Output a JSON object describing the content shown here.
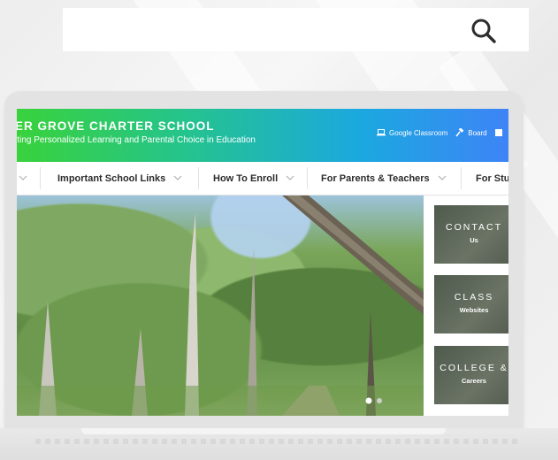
{
  "search": {
    "icon": "search-icon"
  },
  "site": {
    "school_name": "ER GROVE CHARTER SCHOOL",
    "tagline": "rting Personalized Learning and Parental Choice in Education",
    "header_links": [
      {
        "label": "Google Classroom",
        "icon": "laptop-icon"
      },
      {
        "label": "Board",
        "icon": "gavel-icon"
      }
    ]
  },
  "nav": {
    "items": [
      {
        "label": "Important School Links"
      },
      {
        "label": "How To Enroll"
      },
      {
        "label": "For Parents & Teachers"
      },
      {
        "label": "For Stu"
      }
    ]
  },
  "cards": [
    {
      "title": "CONTACT",
      "subtitle": "Us"
    },
    {
      "title": "CLASS",
      "subtitle": "Websites"
    },
    {
      "title": "COLLEGE &",
      "subtitle": "Careers"
    }
  ],
  "colors": {
    "header_start": "#39d23c",
    "header_end": "#3e84f6"
  }
}
